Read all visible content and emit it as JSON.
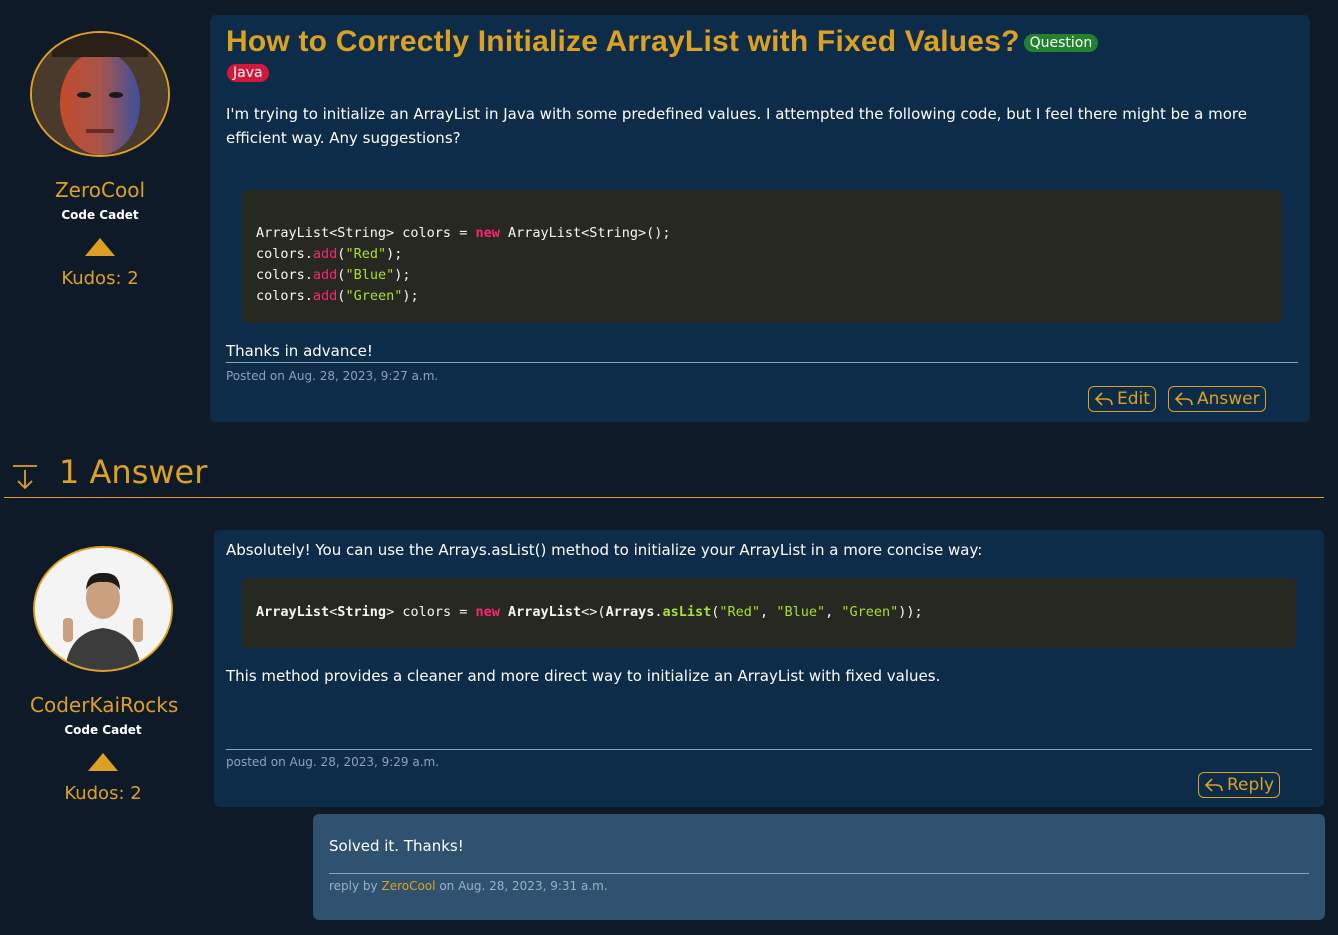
{
  "question": {
    "title": "How to Correctly Initialize ArrayList with Fixed Values?",
    "type_badge": "Question",
    "tag": "Java",
    "intro": "I'm trying to initialize an ArrayList in Java with some predefined values. I attempted the following code, but I feel there might be a more efficient way. Any suggestions?",
    "outro": "Thanks in advance!",
    "posted": "Posted on Aug. 28, 2023, 9:27 a.m.",
    "edit_label": "Edit",
    "answer_label": "Answer",
    "author": {
      "name": "ZeroCool",
      "rank": "Code Cadet",
      "kudos": "Kudos: 2"
    }
  },
  "answers_header": {
    "label": "1 Answer"
  },
  "answer": {
    "intro": "Absolutely! You can use the Arrays.asList() method to initialize your ArrayList in a more concise way:",
    "outro": "This method provides a cleaner and more direct way to initialize an ArrayList with fixed values.",
    "posted": "posted on Aug. 28, 2023, 9:29 a.m.",
    "reply_label": "Reply",
    "author": {
      "name": "CoderKaiRocks",
      "rank": "Code Cadet",
      "kudos": "Kudos: 2"
    }
  },
  "reply": {
    "text": "Solved it. Thanks!",
    "prefix": "reply by",
    "author": "ZeroCool",
    "suffix": "on Aug. 28, 2023, 9:31 a.m."
  },
  "colors": {
    "background": "#0f1a29",
    "card": "#0c2c4a",
    "reply_card": "#2f5270",
    "accent": "#dca122",
    "badge_question": "#22822f",
    "badge_tag": "#d4183c",
    "code_bg": "#272822"
  }
}
